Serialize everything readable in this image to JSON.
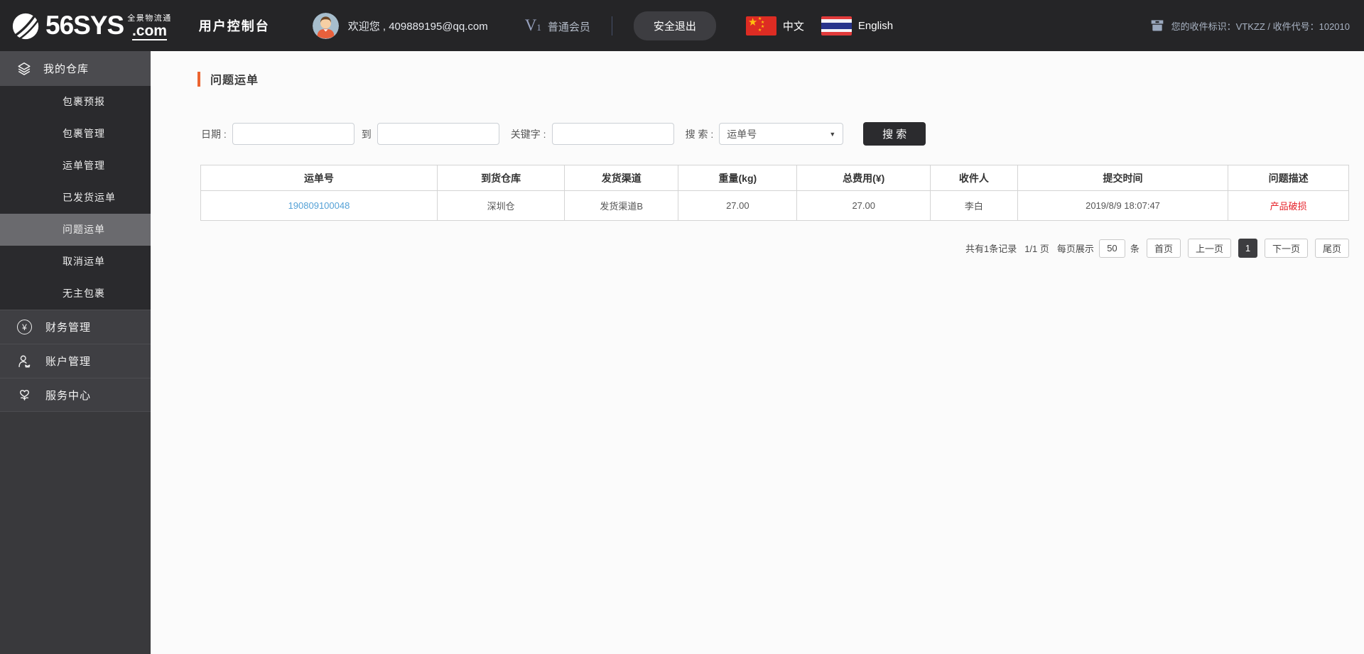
{
  "header": {
    "logo": {
      "brand": "56SYS",
      "domain": ".com",
      "tagline": "全景物流通"
    },
    "console_title": "用户控制台",
    "welcome": "欢迎您 , 409889195@qq.com",
    "membership_badge": "V",
    "membership_level": "1",
    "membership": "普通会员",
    "logout": "安全退出",
    "languages": {
      "cn": "中文",
      "en": "English"
    },
    "shipping_id": "您的收件标识：VTKZZ / 收件代号：102010"
  },
  "sidebar": {
    "sections": [
      {
        "label": "我的仓库",
        "children": [
          "包裹预报",
          "包裹管理",
          "运单管理",
          "已发货运单",
          "问题运单",
          "取消运单",
          "无主包裹"
        ]
      },
      {
        "label": "财务管理"
      },
      {
        "label": "账户管理"
      },
      {
        "label": "服务中心"
      }
    ],
    "active_child": "问题运单"
  },
  "page": {
    "title": "问题运单"
  },
  "filter": {
    "date_label": "日期 :",
    "to_label": "到",
    "keyword_label": "关键字 :",
    "search_label": "搜 索 :",
    "date_from_value": "",
    "date_to_value": "",
    "keyword_value": "",
    "search_type_selected": "运单号",
    "search_button": "搜 索"
  },
  "table": {
    "headers": [
      "运单号",
      "到货仓库",
      "发货渠道",
      "重量(kg)",
      "总费用(¥)",
      "收件人",
      "提交时间",
      "问题描述"
    ],
    "rows": [
      [
        "190809100048",
        "深圳仓",
        "发货渠道B",
        "27.00",
        "27.00",
        "李白",
        "2019/8/9 18:07:47",
        "产品破损"
      ]
    ]
  },
  "pagination": {
    "summary": "共有1条记录",
    "page_info": "1/1 页",
    "per_page_prefix": "每页展示",
    "per_page_value": "50",
    "per_page_suffix": "条",
    "first": "首页",
    "prev": "上一页",
    "current": "1",
    "next": "下一页",
    "last": "尾页"
  },
  "icons": {
    "yen": "¥",
    "caret": "▼",
    "star": "★"
  },
  "colors": {
    "accent": "#EC6430",
    "link": "#55A1D6",
    "danger": "#E62129"
  }
}
